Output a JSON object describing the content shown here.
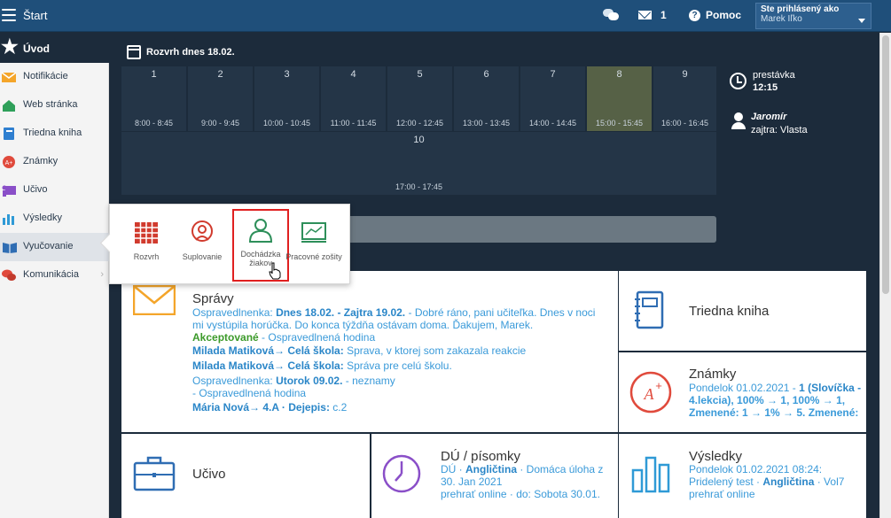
{
  "topbar": {
    "title": "Štart",
    "messages_count": "1",
    "help_label": "Pomoc",
    "user_label": "Ste prihlásený ako",
    "user_name": "Marek Iľko"
  },
  "sidebar": {
    "items": [
      {
        "label": "Úvod",
        "icon": "star-icon"
      },
      {
        "label": "Notifikácie",
        "icon": "envelope-icon"
      },
      {
        "label": "Web stránka",
        "icon": "home-icon"
      },
      {
        "label": "Triedna kniha",
        "icon": "book-icon"
      },
      {
        "label": "Známky",
        "icon": "grade-icon"
      },
      {
        "label": "Učivo",
        "icon": "learning-icon"
      },
      {
        "label": "Výsledky",
        "icon": "bar-chart-icon"
      },
      {
        "label": "Vyučovanie",
        "icon": "open-book-icon"
      },
      {
        "label": "Komunikácia",
        "icon": "chat-icon"
      }
    ]
  },
  "timetable": {
    "heading": "Rozvrh dnes 18.02.",
    "lessons": [
      {
        "num": "1",
        "time": "8:00 - 8:45"
      },
      {
        "num": "2",
        "time": "9:00 - 9:45"
      },
      {
        "num": "3",
        "time": "10:00 - 10:45"
      },
      {
        "num": "4",
        "time": "11:00 - 11:45"
      },
      {
        "num": "5",
        "time": "12:00 - 12:45"
      },
      {
        "num": "6",
        "time": "13:00 - 13:45"
      },
      {
        "num": "7",
        "time": "14:00 - 14:45"
      },
      {
        "num": "8",
        "time": "15:00 - 15:45"
      },
      {
        "num": "9",
        "time": "16:00 - 16:45"
      },
      {
        "num": "10",
        "time": "17:00 - 17:45"
      }
    ],
    "break_label": "prestávka",
    "break_time": "12:15",
    "person_name": "Jaromír",
    "person_tomorrow": "zajtra: Vlasta"
  },
  "popup": {
    "items": [
      {
        "label": "Rozvrh"
      },
      {
        "label": "Suplovanie"
      },
      {
        "label": "Dochádzka žiakov"
      },
      {
        "label": "Pracovné zošity"
      }
    ]
  },
  "spravy": {
    "title": "Správy",
    "l1a": "Ospravedlnenka: ",
    "l1b": "Dnes 18.02. - Zajtra 19.02.",
    "l1c": " - Dobré ráno, pani učiteľka. Dnes v noci",
    "l2": "mi vystúpila horúčka. Do konca týždňa ostávam doma. Ďakujem, Marek.",
    "l3a": "Akceptované",
    "l3b": " - Ospravedlnená hodina",
    "l4a": "Milada Matiková→ Celá škola:",
    "l4b": " Sprava, v ktorej som zakazala reakcie",
    "l5a": "Milada Matiková→ Celá škola:",
    "l5b": " Správa pre celú školu.",
    "l6a": "Ospravedlnenka: ",
    "l6b": "Utorok 09.02.",
    "l6c": " - neznamy",
    "l7": "- Ospravedlnená hodina",
    "l8a": "Mária Nová→ 4.A · Dejepis:",
    "l8b": " c.2"
  },
  "triedna": {
    "title": "Triedna kniha"
  },
  "znamky": {
    "title": "Známky",
    "l1a": "Pondelok 01.02.2021 - ",
    "l1b": "1 (Slovíčka -",
    "l2": "4.lekcia), 100% → 1, 100% → 1,",
    "l3": "Zmenené: 1 → 1% → 5. Zmenené:"
  },
  "ucivo": {
    "title": "Učivo"
  },
  "du": {
    "title": "DÚ / písomky",
    "l1a": "DÚ · ",
    "l1b": "Angličtina",
    "l1c": " · Domáca úloha z",
    "l2": "30. Jan 2021",
    "l3": "prehrať online · do: Sobota 30.01."
  },
  "vysledky": {
    "title": "Výsledky",
    "l1": "Pondelok 01.02.2021 08:24:",
    "l2a": "Pridelený test · ",
    "l2b": "Angličtina",
    "l2c": " · Vol7",
    "l3": "prehrať online"
  }
}
